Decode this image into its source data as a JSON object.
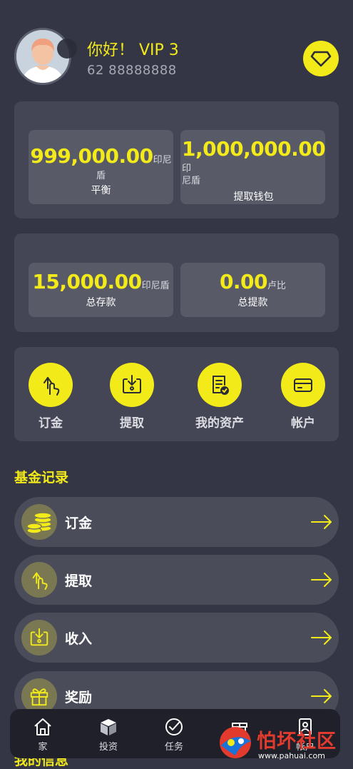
{
  "header": {
    "greeting": "你好！ VIP 3",
    "phone": "62 88888888",
    "vip_icon": "diamond-icon"
  },
  "balances": {
    "balance": {
      "value": "999,000.00",
      "unit": "印尼盾",
      "label": "平衡"
    },
    "withdraw_wallet": {
      "value": "1,000,000.00",
      "unit": "印",
      "unit_wrap": "尼盾",
      "label": "提取钱包"
    }
  },
  "totals": {
    "deposit": {
      "value": "15,000.00",
      "unit": "印尼盾",
      "label": "总存款"
    },
    "withdrawal": {
      "value": "0.00",
      "unit": "卢比",
      "label": "总提款"
    }
  },
  "actions": [
    {
      "label": "订金",
      "icon": "hand-up-icon"
    },
    {
      "label": "提取",
      "icon": "download-box-icon"
    },
    {
      "label": "我的资产",
      "icon": "document-check-icon"
    },
    {
      "label": "帐户",
      "icon": "card-icon"
    }
  ],
  "section_title": "基金记录",
  "records": [
    {
      "label": "订金",
      "icon": "coins-icon"
    },
    {
      "label": "提取",
      "icon": "hand-up-icon"
    },
    {
      "label": "收入",
      "icon": "download-box-icon"
    },
    {
      "label": "奖励",
      "icon": "gift-icon"
    }
  ],
  "next_section_title": "我的信息",
  "tabbar": [
    {
      "label": "家",
      "icon": "home-icon"
    },
    {
      "label": "投资",
      "icon": "cube-icon"
    },
    {
      "label": "任务",
      "icon": "check-circle-icon"
    },
    {
      "label": "",
      "icon": "gift-icon"
    },
    {
      "label": "帐户",
      "icon": "id-card-icon"
    }
  ],
  "watermark": {
    "text": "怕坏社区",
    "url": "www.pahuai.com"
  },
  "colors": {
    "accent": "#f3ea1a",
    "background": "#343646",
    "card": "#444655",
    "tabbar": "#1f2029"
  }
}
